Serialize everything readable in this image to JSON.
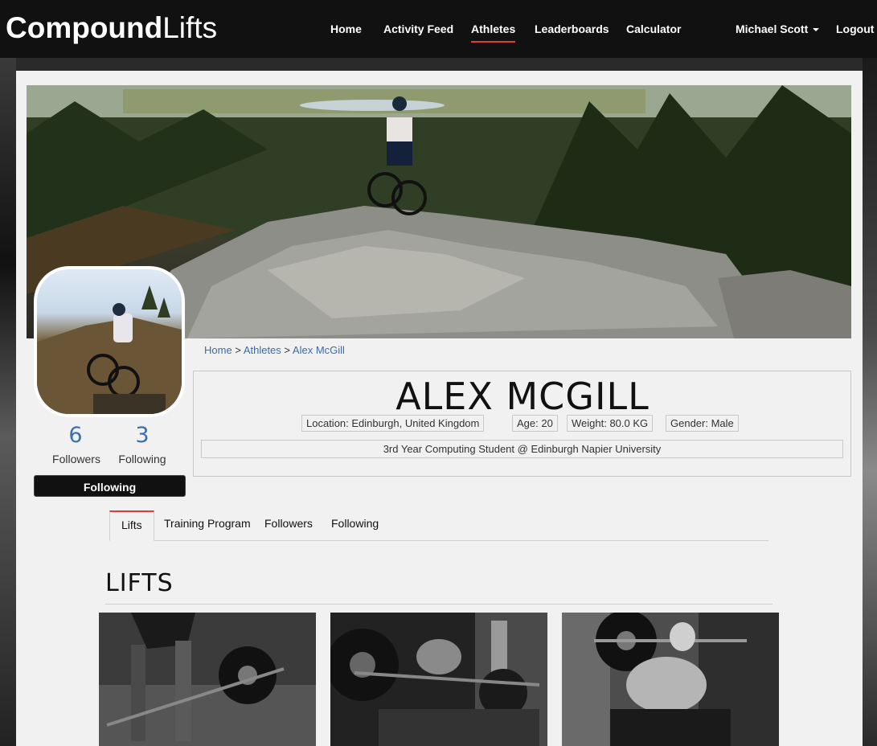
{
  "brand": {
    "bold": "Compound",
    "light": "Lifts"
  },
  "nav": {
    "items": [
      {
        "label": "Home"
      },
      {
        "label": "Activity Feed"
      },
      {
        "label": "Athletes",
        "active": true
      },
      {
        "label": "Leaderboards"
      },
      {
        "label": "Calculator"
      }
    ],
    "user": "Michael Scott",
    "logout": "Logout"
  },
  "breadcrumb": [
    "Home",
    "Athletes",
    "Alex McGill"
  ],
  "breadcrumb_sep": ">",
  "profile": {
    "name": "ALEX MCGILL",
    "location": "Location: Edinburgh, United Kingdom",
    "age": "Age: 20",
    "weight": "Weight: 80.0 KG",
    "gender": "Gender: Male",
    "bio": "3rd Year Computing Student @ Edinburgh Napier University"
  },
  "stats": {
    "followers_count": "6",
    "followers_label": "Followers",
    "following_count": "3",
    "following_label": "Following"
  },
  "follow_button": "Following",
  "tabs": [
    {
      "label": "Lifts",
      "active": true
    },
    {
      "label": "Training Program"
    },
    {
      "label": "Followers"
    },
    {
      "label": "Following"
    }
  ],
  "section_title": "LIFTS",
  "colors": {
    "accent": "#e03a3e",
    "link": "#3a6ca8",
    "nav_bg": "#111111",
    "panel_bg": "#f1f1f1"
  }
}
